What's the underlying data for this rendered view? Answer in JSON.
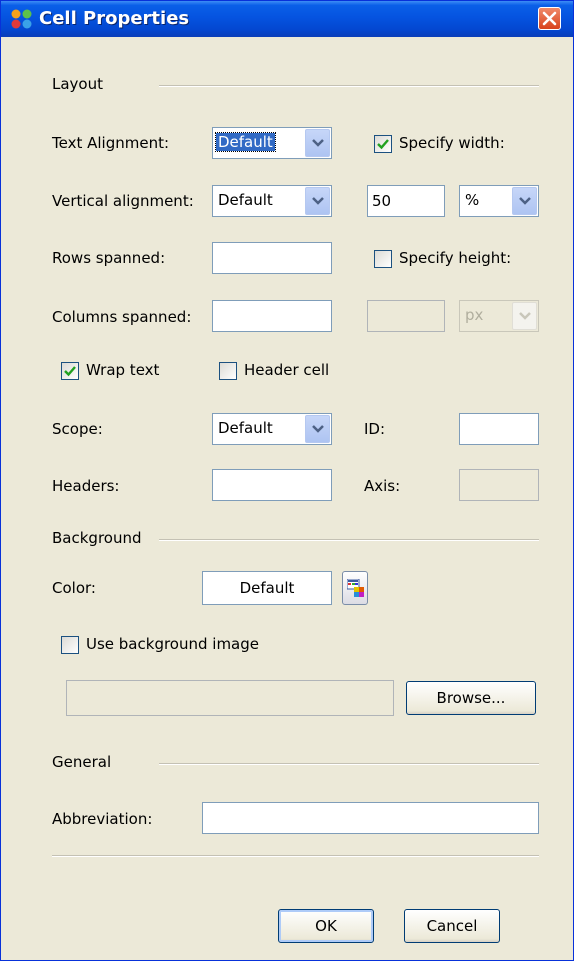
{
  "window": {
    "title": "Cell Properties",
    "colors": {
      "titlebar": "#0553e0",
      "close": "#d8421c",
      "face": "#ece9d8"
    }
  },
  "layout_section": {
    "heading": "Layout",
    "text_alignment_label": "Text Alignment:",
    "text_alignment_value": "Default",
    "specify_width_label": "Specify width:",
    "specify_width_checked": true,
    "vertical_alignment_label": "Vertical alignment:",
    "vertical_alignment_value": "Default",
    "width_value": "50",
    "width_unit": "%",
    "rows_spanned_label": "Rows spanned:",
    "rows_spanned_value": "",
    "specify_height_label": "Specify height:",
    "specify_height_checked": false,
    "columns_spanned_label": "Columns spanned:",
    "columns_spanned_value": "",
    "height_value": "",
    "height_unit": "px",
    "wrap_text_label": "Wrap text",
    "wrap_text_checked": true,
    "header_cell_label": "Header cell",
    "header_cell_checked": false,
    "scope_label": "Scope:",
    "scope_value": "Default",
    "id_label": "ID:",
    "id_value": "",
    "headers_label": "Headers:",
    "headers_value": "",
    "axis_label": "Axis:",
    "axis_value": ""
  },
  "background_section": {
    "heading": "Background",
    "color_label": "Color:",
    "color_value": "Default",
    "color_picker_icon": "color-palette-icon",
    "use_image_label": "Use background image",
    "use_image_checked": false,
    "image_path": "",
    "browse_label": "Browse..."
  },
  "general_section": {
    "heading": "General",
    "abbreviation_label": "Abbreviation:",
    "abbreviation_value": ""
  },
  "footer": {
    "ok_label": "OK",
    "cancel_label": "Cancel"
  }
}
